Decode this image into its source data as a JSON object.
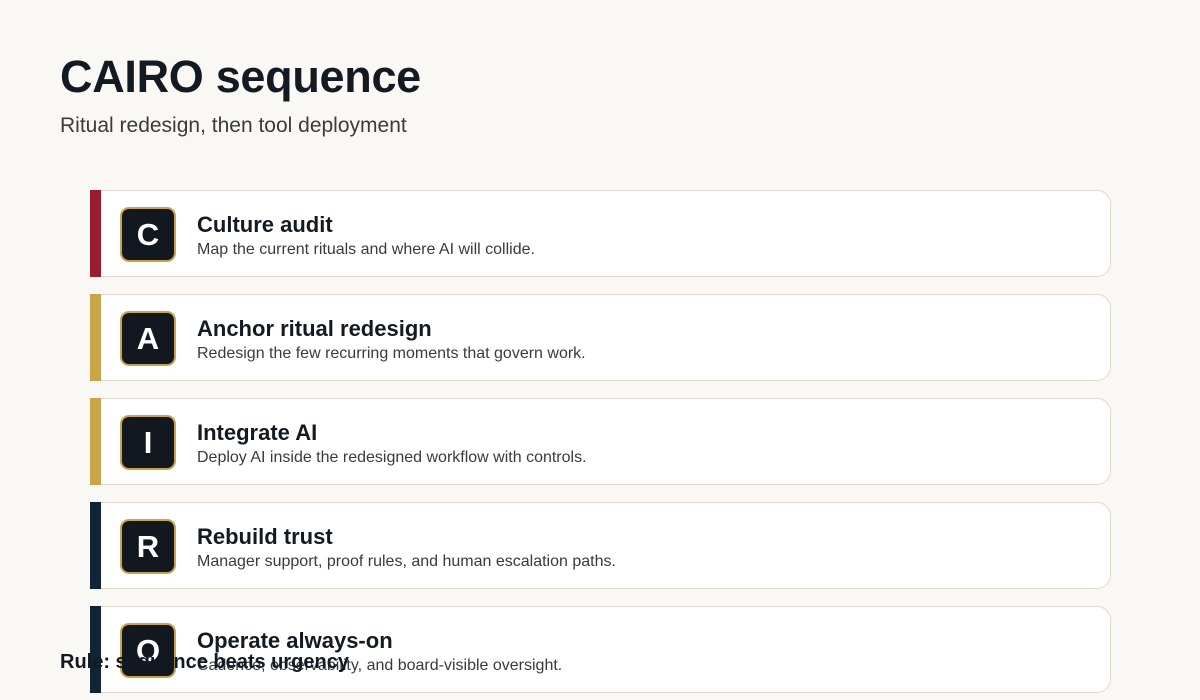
{
  "header": {
    "title": "CAIRO sequence",
    "subtitle": "Ritual redesign, then tool deployment"
  },
  "steps": [
    {
      "letter": "C",
      "title": "Culture audit",
      "description": "Map the current rituals and where AI will collide.",
      "accent_color": "#9b1c31"
    },
    {
      "letter": "A",
      "title": "Anchor ritual redesign",
      "description": "Redesign the few recurring moments that govern work.",
      "accent_color": "#c9a449"
    },
    {
      "letter": "I",
      "title": "Integrate AI",
      "description": "Deploy AI inside the redesigned workflow with controls.",
      "accent_color": "#c9a449"
    },
    {
      "letter": "R",
      "title": "Rebuild trust",
      "description": "Manager support, proof rules, and human escalation paths.",
      "accent_color": "#0f2537"
    },
    {
      "letter": "O",
      "title": "Operate always-on",
      "description": "Cadence, observability, and board-visible oversight.",
      "accent_color": "#0f2537"
    }
  ],
  "footer": {
    "rule": "Rule: sequence beats urgency"
  },
  "colors": {
    "background": "#faf8f4",
    "badge_fill": "#111820",
    "badge_border": "#c7a550",
    "card_border": "#e2d9cc"
  }
}
